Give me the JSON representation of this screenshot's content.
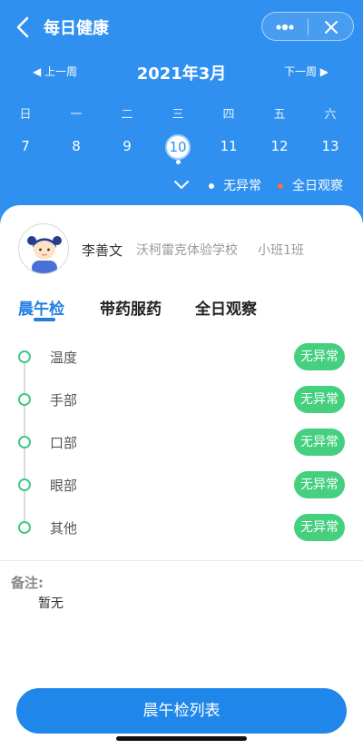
{
  "header": {
    "title": "每日健康",
    "back_icon": "chevron-left-icon",
    "more_icon": "more-dots-icon",
    "close_icon": "close-icon"
  },
  "calendar": {
    "prev_week_label": "上一周",
    "next_week_label": "下一周",
    "month_title": "2021年3月",
    "weekdays": [
      "日",
      "一",
      "二",
      "三",
      "四",
      "五",
      "六"
    ],
    "dates": [
      "7",
      "8",
      "9",
      "10",
      "11",
      "12",
      "13"
    ],
    "selected_date": "10"
  },
  "legend": {
    "normal_label": "无异常",
    "all_day_label": "全日观察",
    "normal_color": "#ffffff",
    "all_day_color": "#ff6a4d"
  },
  "student": {
    "name": "李善文",
    "school": "沃柯雷克体验学校",
    "class": "小班1班"
  },
  "tabs": [
    "晨午检",
    "带药服药",
    "全日观察"
  ],
  "checks": [
    {
      "label": "温度",
      "status": "无异常"
    },
    {
      "label": "手部",
      "status": "无异常"
    },
    {
      "label": "口部",
      "status": "无异常"
    },
    {
      "label": "眼部",
      "status": "无异常"
    },
    {
      "label": "其他",
      "status": "无异常"
    }
  ],
  "note": {
    "label": "备注:",
    "value": "暂无"
  },
  "primary_button": "晨午检列表",
  "colors": {
    "header_blue": "#2f90f0",
    "accent_blue": "#1f7fe5",
    "status_green": "#44d07f"
  }
}
